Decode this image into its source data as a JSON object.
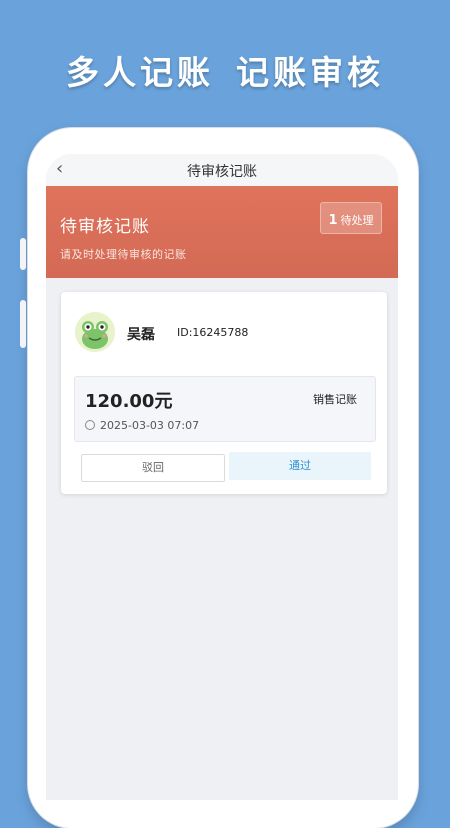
{
  "promo": {
    "title_part1": "多人记账",
    "title_part2": "记账审核"
  },
  "nav": {
    "back_icon": "chevron-left-icon",
    "title": "待审核记账"
  },
  "banner": {
    "title": "待审核记账",
    "subtitle": "请及时处理待审核的记账",
    "pending_count": "1",
    "pending_label": "待处理",
    "color": "#d86d57"
  },
  "card": {
    "avatar_icon": "frog-avatar-icon",
    "user_name": "吴磊",
    "user_id": "ID:16245788",
    "amount": "120.00元",
    "entry_type": "销售记账",
    "timestamp": "2025-03-03 07:07",
    "reject_label": "驳回",
    "approve_label": "通过",
    "approve_color": "#2f8fd1"
  }
}
